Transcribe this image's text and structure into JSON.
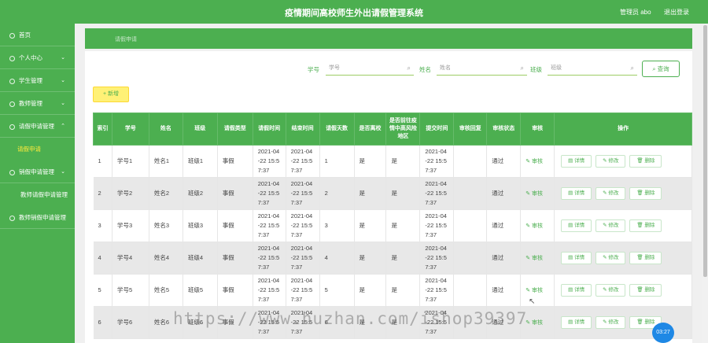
{
  "header": {
    "title": "疫情期间高校师生外出请假管理系统",
    "admin_label": "管理员 abo",
    "logout_label": "退出登录"
  },
  "sidebar": {
    "items": [
      {
        "label": "首页"
      },
      {
        "label": "个人中心",
        "chevron": "⌄"
      },
      {
        "label": "学生管理",
        "chevron": "⌄"
      },
      {
        "label": "教师管理",
        "chevron": "⌄"
      },
      {
        "label": "请假申请管理",
        "chevron": "⌃"
      },
      {
        "label": "请假申请"
      },
      {
        "label": "销假申请管理",
        "chevron": "⌄"
      },
      {
        "label": "教师请假申请管理"
      },
      {
        "label": "教师销假申请管理"
      }
    ]
  },
  "breadcrumb": {
    "current": "请假申请"
  },
  "search": {
    "student_id_label": "学号",
    "student_id_placeholder": "学号",
    "name_label": "姓名",
    "name_placeholder": "姓名",
    "class_label": "班级",
    "class_placeholder": "班级",
    "query_label": "查询",
    "search_glyph": "⌕"
  },
  "toolbar": {
    "add_label": "+ 新增"
  },
  "table": {
    "headers": [
      "索引",
      "学号",
      "姓名",
      "班级",
      "请假类型",
      "请假时间",
      "结束时间",
      "请假天数",
      "是否离校",
      "是否前往疫情中高风险地区",
      "提交时间",
      "审核回复",
      "审核状态",
      "审核",
      "操作"
    ],
    "audit_label": "✎ 审核",
    "detail_label": "▤ 详情",
    "edit_label": "✎ 修改",
    "delete_label": "🗑 删除",
    "rows": [
      {
        "index": "1",
        "sid": "学号1",
        "name": "姓名1",
        "cls": "班级1",
        "type": "事假",
        "start": "2021-04 -22 15:5 7:37",
        "end": "2021-04 -22 15:5 7:37",
        "days": "1",
        "leave": "是",
        "risk": "是",
        "submit": "2021-04 -22 15:5 7:37",
        "reply": "",
        "status": "通过"
      },
      {
        "index": "2",
        "sid": "学号2",
        "name": "姓名2",
        "cls": "班级2",
        "type": "事假",
        "start": "2021-04 -22 15:5 7:37",
        "end": "2021-04 -22 15:5 7:37",
        "days": "2",
        "leave": "是",
        "risk": "是",
        "submit": "2021-04 -22 15:5 7:37",
        "reply": "",
        "status": "通过"
      },
      {
        "index": "3",
        "sid": "学号3",
        "name": "姓名3",
        "cls": "班级3",
        "type": "事假",
        "start": "2021-04 -22 15:5 7:37",
        "end": "2021-04 -22 15:5 7:37",
        "days": "3",
        "leave": "是",
        "risk": "是",
        "submit": "2021-04 -22 15:5 7:37",
        "reply": "",
        "status": "通过"
      },
      {
        "index": "4",
        "sid": "学号4",
        "name": "姓名4",
        "cls": "班级4",
        "type": "事假",
        "start": "2021-04 -22 15:5 7:37",
        "end": "2021-04 -22 15:5 7:37",
        "days": "4",
        "leave": "是",
        "risk": "是",
        "submit": "2021-04 -22 15:5 7:37",
        "reply": "",
        "status": "通过"
      },
      {
        "index": "5",
        "sid": "学号5",
        "name": "姓名5",
        "cls": "班级5",
        "type": "事假",
        "start": "2021-04 -22 15:5 7:37",
        "end": "2021-04 -22 15:5 7:37",
        "days": "5",
        "leave": "是",
        "risk": "是",
        "submit": "2021-04 -22 15:5 7:37",
        "reply": "",
        "status": "通过"
      },
      {
        "index": "6",
        "sid": "学号6",
        "name": "姓名6",
        "cls": "班级6",
        "type": "事假",
        "start": "2021-04 -22 15:5 7:37",
        "end": "2021-04 -22 15:5 7:37",
        "days": "6",
        "leave": "是",
        "risk": "是",
        "submit": "2021-04 -22 15:5 7:37",
        "reply": "",
        "status": "通过"
      }
    ]
  },
  "overlay": {
    "watermark": "https://www.huzhan.com/ishop39397",
    "timer": "03:27"
  },
  "colors": {
    "accent": "#4caf50",
    "add_button": "#fff176",
    "timer": "#1e88e5"
  }
}
